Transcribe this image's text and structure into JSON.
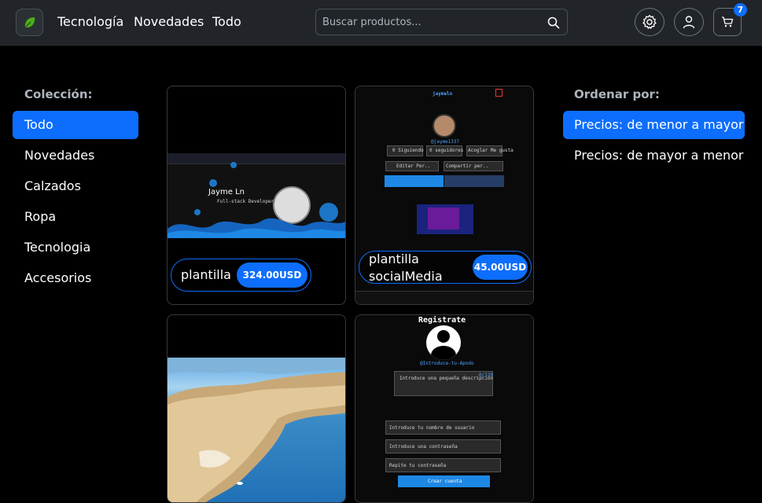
{
  "nav": {
    "links": [
      "Tecnología",
      "Novedades",
      "Todo"
    ],
    "search_placeholder": "Buscar productos...",
    "cart_count": "7",
    "brand_color": "#4caf1a",
    "accent": "#0d6efd"
  },
  "sidebar": {
    "title": "Colección:",
    "items": [
      "Todo",
      "Novedades",
      "Calzados",
      "Ropa",
      "Tecnologia",
      "Accesorios"
    ],
    "active": "Todo"
  },
  "sort": {
    "title": "Ordenar por:",
    "items": [
      "Precios: de menor a mayor",
      "Precios: de mayor a menor"
    ],
    "active": "Precios: de menor a mayor"
  },
  "products": [
    {
      "name": "plantilla",
      "price": "324.00USD",
      "preview": {
        "name": "Jayme Ln",
        "subtitle": "Full-stack Developer"
      }
    },
    {
      "name": "plantilla socialMedia",
      "price": "45.00USD",
      "preview": {
        "user": "jaymeln",
        "handle": "@jayme1337",
        "stats": [
          "0 Siguiendo",
          "0 seguidores",
          "Acoglar Me gusta"
        ],
        "buttons": [
          "Editar Per..",
          "Compartir per.."
        ]
      }
    },
    {
      "name": "",
      "price": "",
      "preview": {}
    },
    {
      "name": "",
      "price": "",
      "preview": {
        "title": "Registrate",
        "handle": "@Introduce-tu-Apodo",
        "counter": "0/120",
        "desc_placeholder": "Introduce una pequeña descripción",
        "fields": [
          "Introduce tu nombre de usuario",
          "Introduce una contraseña",
          "Repite tu contraseña"
        ],
        "submit": "Crear cuenta"
      }
    }
  ]
}
